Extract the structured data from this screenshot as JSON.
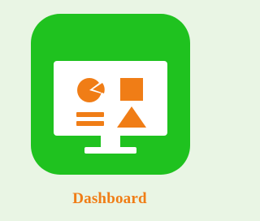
{
  "app": {
    "label": "Dashboard",
    "icon": "monitor-dashboard-icon"
  },
  "colors": {
    "background": "#e9f5e4",
    "icon_bg": "#1fc21f",
    "screen": "#ffffff",
    "accent": "#f07d16",
    "label": "#f07d16"
  }
}
